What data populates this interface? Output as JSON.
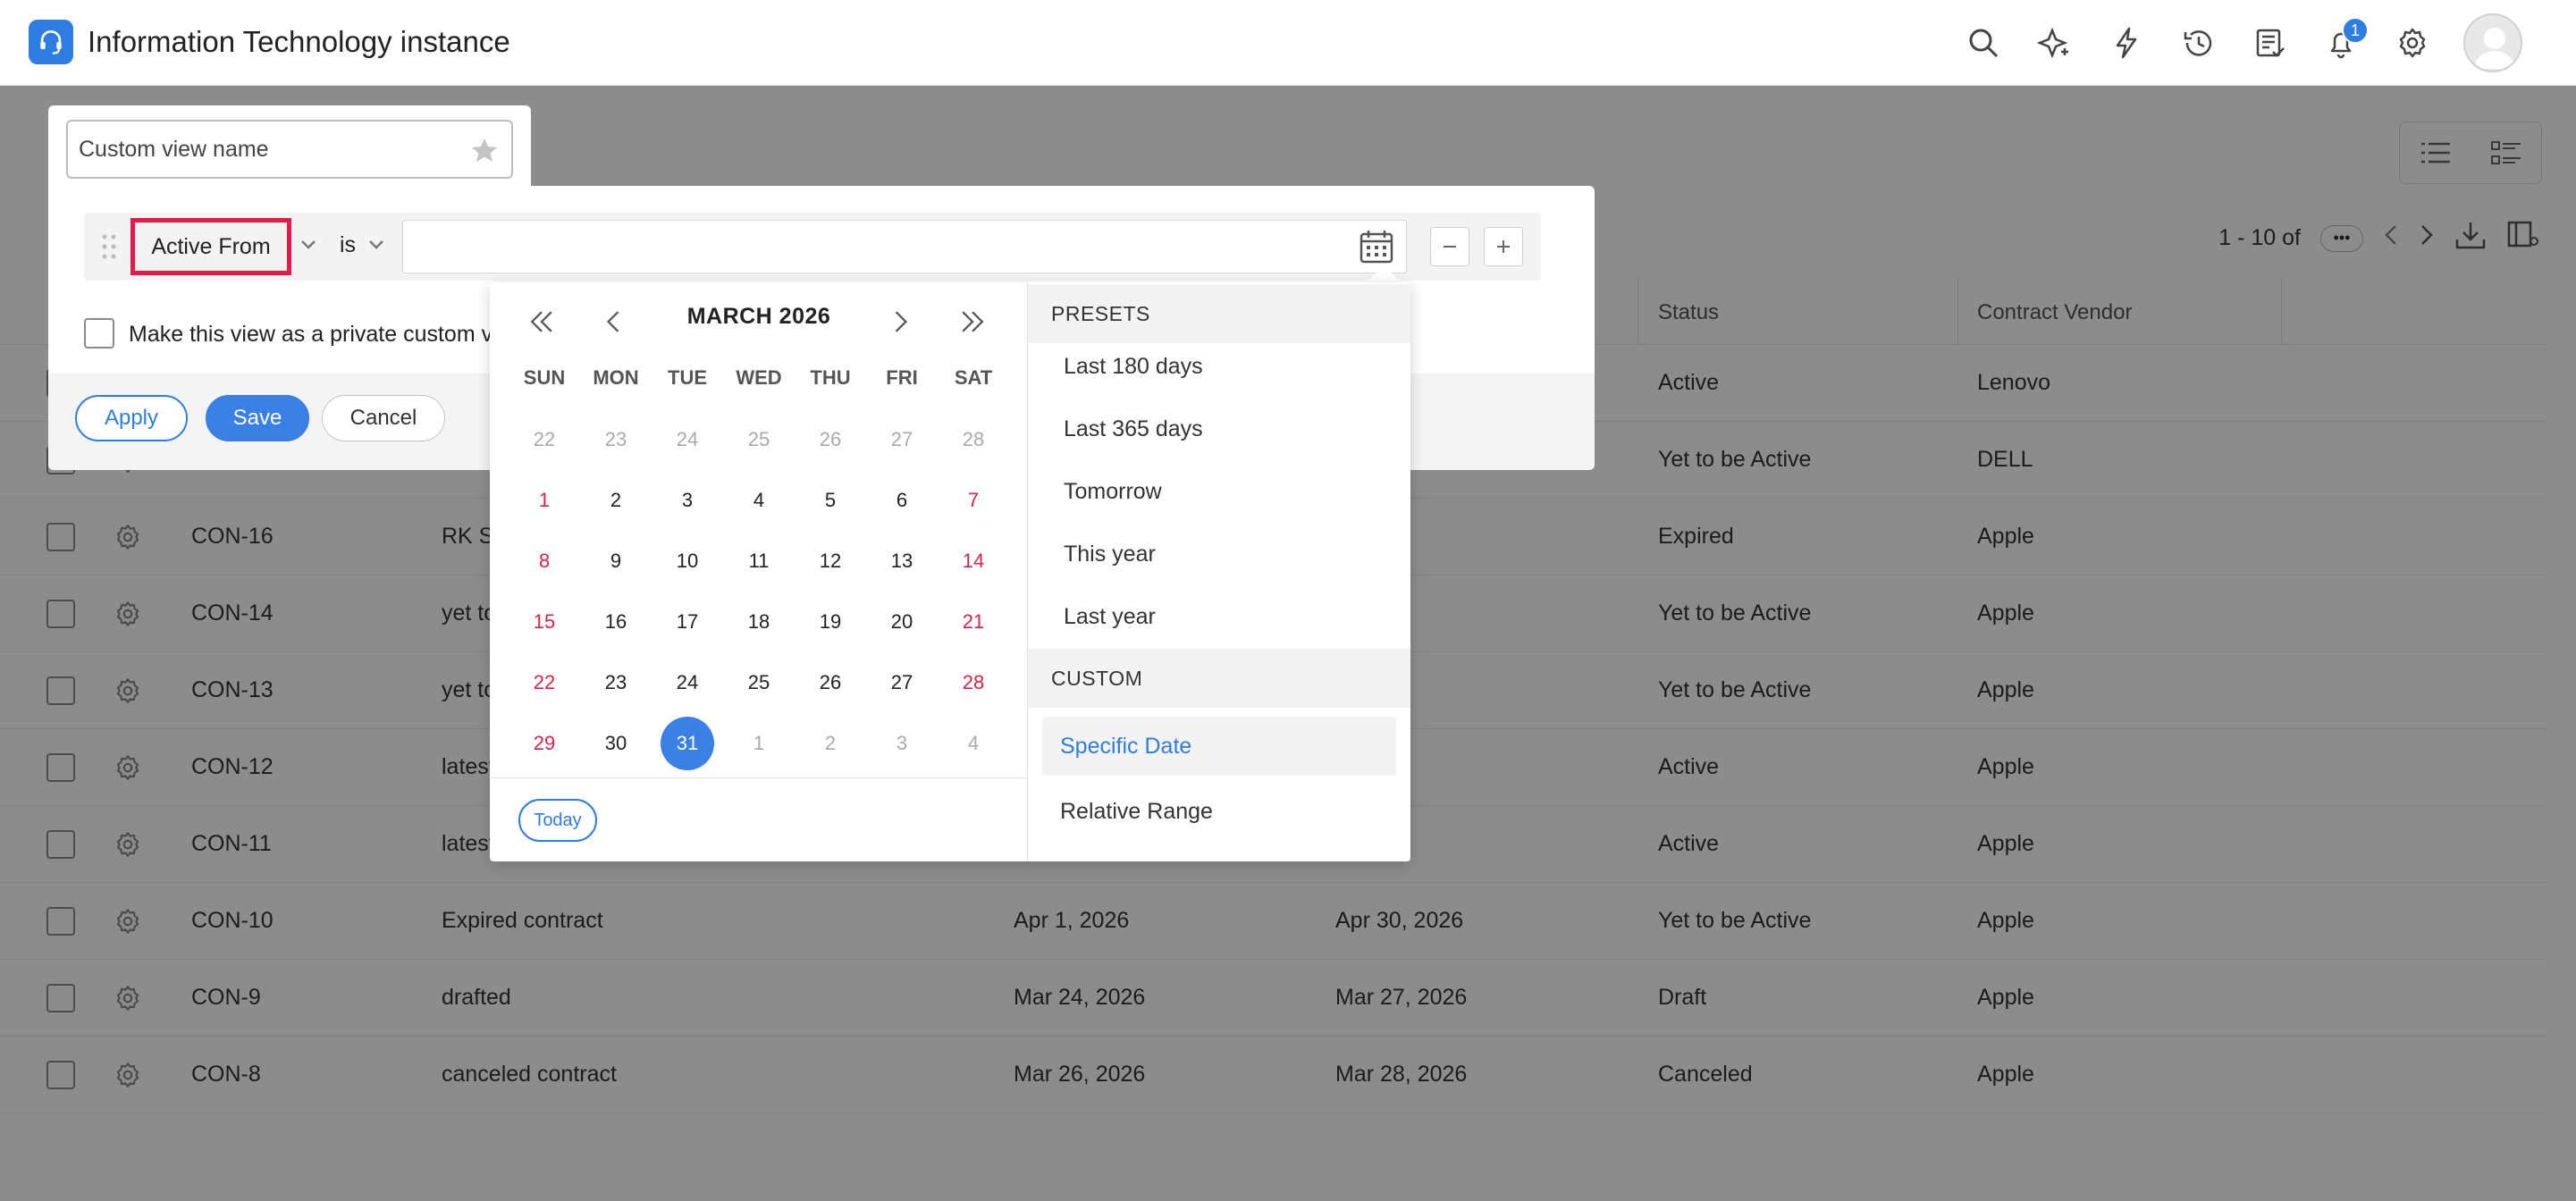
{
  "app": {
    "title": "Information Technology instance",
    "notification_count": "1"
  },
  "header_icons": [
    "search-icon",
    "sparkle-icon",
    "lightning-icon",
    "history-icon",
    "checklist-icon",
    "bell-icon",
    "gear-icon",
    "avatar"
  ],
  "pager": {
    "range": "1 - 10 of"
  },
  "table": {
    "headers": {
      "status": "Status",
      "vendor": "Contract Vendor"
    },
    "rows": [
      {
        "id": "",
        "name": "",
        "start": "",
        "end": "",
        "status": "Active",
        "vendor": "Lenovo"
      },
      {
        "id": "",
        "name": "",
        "start": "",
        "end": "",
        "status": "Yet to be Active",
        "vendor": "DELL"
      },
      {
        "id": "CON-16",
        "name": "RK Su",
        "start": "",
        "end": "2026",
        "status": "Expired",
        "vendor": "Apple"
      },
      {
        "id": "CON-14",
        "name": "yet to",
        "start": "",
        "end": "2026",
        "status": "Yet to be Active",
        "vendor": "Apple"
      },
      {
        "id": "CON-13",
        "name": "yet to",
        "start": "",
        "end": "2026",
        "status": "Yet to be Active",
        "vendor": "Apple"
      },
      {
        "id": "CON-12",
        "name": "latest",
        "start": "",
        "end": "2026",
        "status": "Active",
        "vendor": "Apple"
      },
      {
        "id": "CON-11",
        "name": "latest",
        "start": "",
        "end": "2026",
        "status": "Active",
        "vendor": "Apple"
      },
      {
        "id": "CON-10",
        "name": "Expired contract",
        "start": "Apr 1, 2026",
        "end": "Apr 30, 2026",
        "status": "Yet to be Active",
        "vendor": "Apple"
      },
      {
        "id": "CON-9",
        "name": "drafted",
        "start": "Mar 24, 2026",
        "end": "Mar 27, 2026",
        "status": "Draft",
        "vendor": "Apple"
      },
      {
        "id": "CON-8",
        "name": "canceled contract",
        "start": "Mar 26, 2026",
        "end": "Mar 28, 2026",
        "status": "Canceled",
        "vendor": "Apple"
      }
    ]
  },
  "custom_view": {
    "name_placeholder": "Custom view name",
    "criteria": {
      "field": "Active From",
      "operator": "is",
      "value": ""
    },
    "private_label": "Make this view as a private custom vie",
    "apply": "Apply",
    "save": "Save",
    "cancel": "Cancel"
  },
  "date_picker": {
    "month_label": "MARCH 2026",
    "weekdays": [
      "SUN",
      "MON",
      "TUE",
      "WED",
      "THU",
      "FRI",
      "SAT"
    ],
    "weeks": [
      [
        "22",
        "23",
        "24",
        "25",
        "26",
        "27",
        "28"
      ],
      [
        "1",
        "2",
        "3",
        "4",
        "5",
        "6",
        "7"
      ],
      [
        "8",
        "9",
        "10",
        "11",
        "12",
        "13",
        "14"
      ],
      [
        "15",
        "16",
        "17",
        "18",
        "19",
        "20",
        "21"
      ],
      [
        "22",
        "23",
        "24",
        "25",
        "26",
        "27",
        "28"
      ],
      [
        "29",
        "30",
        "31",
        "1",
        "2",
        "3",
        "4"
      ]
    ],
    "selected_day": "31",
    "today_label": "Today",
    "presets_heading": "PRESETS",
    "presets": [
      "Last 180 days",
      "Last 365 days",
      "Tomorrow",
      "This year",
      "Last year"
    ],
    "custom_heading": "CUSTOM",
    "custom_options": [
      "Specific Date",
      "Relative Range"
    ],
    "custom_selected": "Specific Date"
  },
  "colors": {
    "accent": "#2f7de1",
    "weekend": "#d6244d",
    "highlight_border": "#e5194a"
  }
}
